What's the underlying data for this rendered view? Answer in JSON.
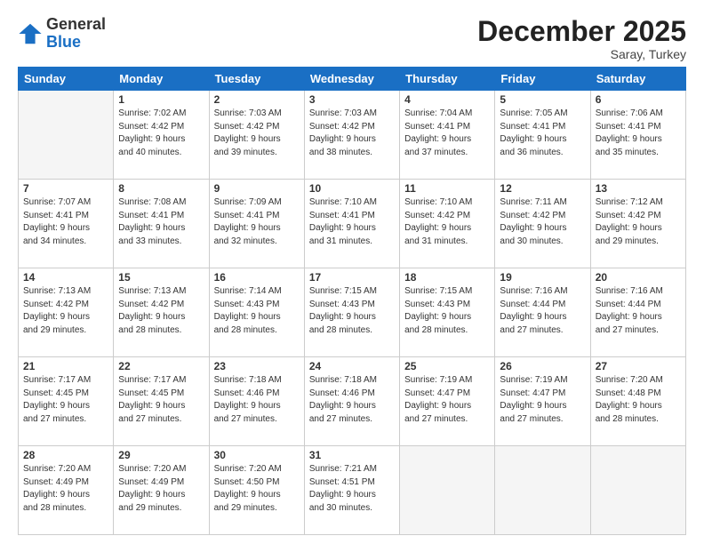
{
  "header": {
    "logo_general": "General",
    "logo_blue": "Blue",
    "month": "December 2025",
    "location": "Saray, Turkey"
  },
  "days_of_week": [
    "Sunday",
    "Monday",
    "Tuesday",
    "Wednesday",
    "Thursday",
    "Friday",
    "Saturday"
  ],
  "weeks": [
    [
      {
        "day": "",
        "info": "",
        "empty": true
      },
      {
        "day": "1",
        "info": "Sunrise: 7:02 AM\nSunset: 4:42 PM\nDaylight: 9 hours\nand 40 minutes."
      },
      {
        "day": "2",
        "info": "Sunrise: 7:03 AM\nSunset: 4:42 PM\nDaylight: 9 hours\nand 39 minutes."
      },
      {
        "day": "3",
        "info": "Sunrise: 7:03 AM\nSunset: 4:42 PM\nDaylight: 9 hours\nand 38 minutes."
      },
      {
        "day": "4",
        "info": "Sunrise: 7:04 AM\nSunset: 4:41 PM\nDaylight: 9 hours\nand 37 minutes."
      },
      {
        "day": "5",
        "info": "Sunrise: 7:05 AM\nSunset: 4:41 PM\nDaylight: 9 hours\nand 36 minutes."
      },
      {
        "day": "6",
        "info": "Sunrise: 7:06 AM\nSunset: 4:41 PM\nDaylight: 9 hours\nand 35 minutes."
      }
    ],
    [
      {
        "day": "7",
        "info": "Sunrise: 7:07 AM\nSunset: 4:41 PM\nDaylight: 9 hours\nand 34 minutes."
      },
      {
        "day": "8",
        "info": "Sunrise: 7:08 AM\nSunset: 4:41 PM\nDaylight: 9 hours\nand 33 minutes."
      },
      {
        "day": "9",
        "info": "Sunrise: 7:09 AM\nSunset: 4:41 PM\nDaylight: 9 hours\nand 32 minutes."
      },
      {
        "day": "10",
        "info": "Sunrise: 7:10 AM\nSunset: 4:41 PM\nDaylight: 9 hours\nand 31 minutes."
      },
      {
        "day": "11",
        "info": "Sunrise: 7:10 AM\nSunset: 4:42 PM\nDaylight: 9 hours\nand 31 minutes."
      },
      {
        "day": "12",
        "info": "Sunrise: 7:11 AM\nSunset: 4:42 PM\nDaylight: 9 hours\nand 30 minutes."
      },
      {
        "day": "13",
        "info": "Sunrise: 7:12 AM\nSunset: 4:42 PM\nDaylight: 9 hours\nand 29 minutes."
      }
    ],
    [
      {
        "day": "14",
        "info": "Sunrise: 7:13 AM\nSunset: 4:42 PM\nDaylight: 9 hours\nand 29 minutes."
      },
      {
        "day": "15",
        "info": "Sunrise: 7:13 AM\nSunset: 4:42 PM\nDaylight: 9 hours\nand 28 minutes."
      },
      {
        "day": "16",
        "info": "Sunrise: 7:14 AM\nSunset: 4:43 PM\nDaylight: 9 hours\nand 28 minutes."
      },
      {
        "day": "17",
        "info": "Sunrise: 7:15 AM\nSunset: 4:43 PM\nDaylight: 9 hours\nand 28 minutes."
      },
      {
        "day": "18",
        "info": "Sunrise: 7:15 AM\nSunset: 4:43 PM\nDaylight: 9 hours\nand 28 minutes."
      },
      {
        "day": "19",
        "info": "Sunrise: 7:16 AM\nSunset: 4:44 PM\nDaylight: 9 hours\nand 27 minutes."
      },
      {
        "day": "20",
        "info": "Sunrise: 7:16 AM\nSunset: 4:44 PM\nDaylight: 9 hours\nand 27 minutes."
      }
    ],
    [
      {
        "day": "21",
        "info": "Sunrise: 7:17 AM\nSunset: 4:45 PM\nDaylight: 9 hours\nand 27 minutes."
      },
      {
        "day": "22",
        "info": "Sunrise: 7:17 AM\nSunset: 4:45 PM\nDaylight: 9 hours\nand 27 minutes."
      },
      {
        "day": "23",
        "info": "Sunrise: 7:18 AM\nSunset: 4:46 PM\nDaylight: 9 hours\nand 27 minutes."
      },
      {
        "day": "24",
        "info": "Sunrise: 7:18 AM\nSunset: 4:46 PM\nDaylight: 9 hours\nand 27 minutes."
      },
      {
        "day": "25",
        "info": "Sunrise: 7:19 AM\nSunset: 4:47 PM\nDaylight: 9 hours\nand 27 minutes."
      },
      {
        "day": "26",
        "info": "Sunrise: 7:19 AM\nSunset: 4:47 PM\nDaylight: 9 hours\nand 27 minutes."
      },
      {
        "day": "27",
        "info": "Sunrise: 7:20 AM\nSunset: 4:48 PM\nDaylight: 9 hours\nand 28 minutes."
      }
    ],
    [
      {
        "day": "28",
        "info": "Sunrise: 7:20 AM\nSunset: 4:49 PM\nDaylight: 9 hours\nand 28 minutes."
      },
      {
        "day": "29",
        "info": "Sunrise: 7:20 AM\nSunset: 4:49 PM\nDaylight: 9 hours\nand 29 minutes."
      },
      {
        "day": "30",
        "info": "Sunrise: 7:20 AM\nSunset: 4:50 PM\nDaylight: 9 hours\nand 29 minutes."
      },
      {
        "day": "31",
        "info": "Sunrise: 7:21 AM\nSunset: 4:51 PM\nDaylight: 9 hours\nand 30 minutes."
      },
      {
        "day": "",
        "info": "",
        "empty": true
      },
      {
        "day": "",
        "info": "",
        "empty": true
      },
      {
        "day": "",
        "info": "",
        "empty": true
      }
    ]
  ]
}
